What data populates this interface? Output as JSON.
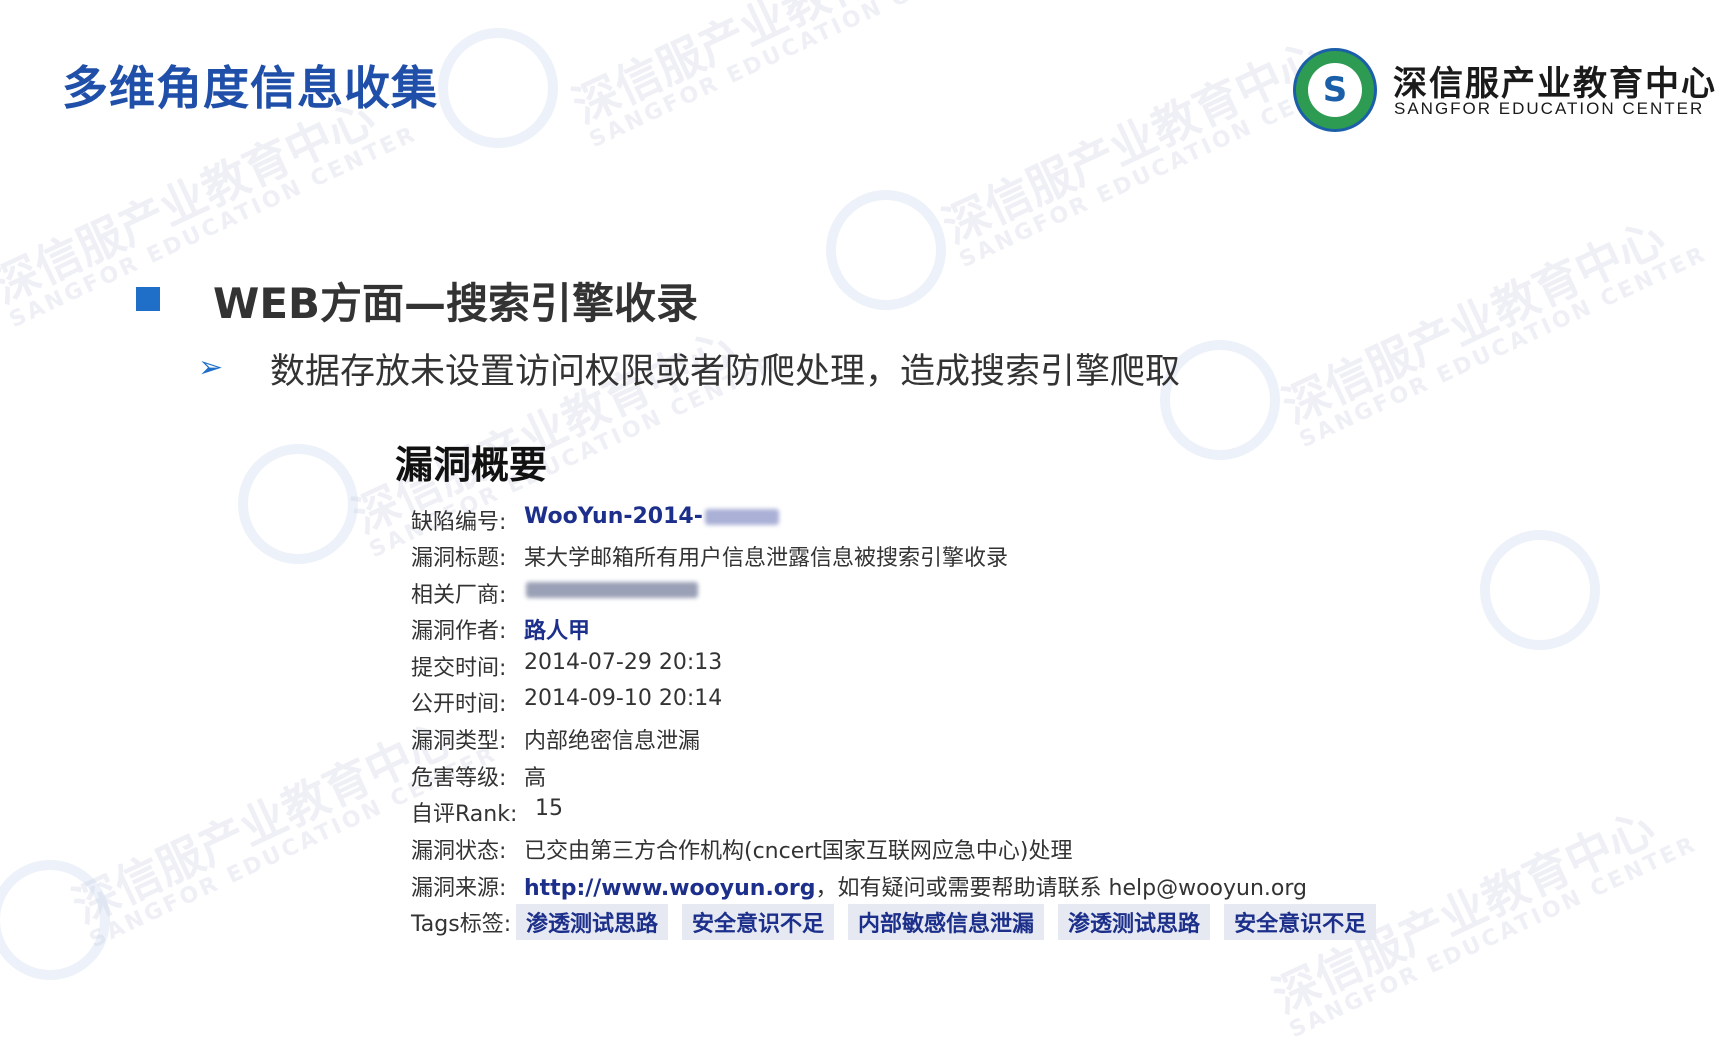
{
  "slide": {
    "title": "多维角度信息收集",
    "heading": "WEB方面—搜索引擎收录",
    "subpoint": "数据存放未设置访问权限或者防爬处理，造成搜索引擎爬取"
  },
  "logo": {
    "name_cn": "深信服产业教育中心",
    "name_en": "SANGFOR EDUCATION CENTER"
  },
  "watermark": {
    "text_cn": "深信服产业教育中心",
    "text_en": "SANGFOR EDUCATION CENTER"
  },
  "vuln": {
    "title": "漏洞概要",
    "id_label": "缺陷编号:",
    "id_value": "WooYun-2014-",
    "subject_label": "漏洞标题:",
    "subject_value": "某大学邮箱所有用户信息泄露信息被搜索引擎收录",
    "vendor_label": "相关厂商:",
    "author_label": "漏洞作者:",
    "author_value": "路人甲",
    "submitted_label": "提交时间:",
    "submitted_value": "2014-07-29 20:13",
    "published_label": "公开时间:",
    "published_value": "2014-09-10 20:14",
    "type_label": "漏洞类型:",
    "type_value": "内部绝密信息泄漏",
    "severity_label": "危害等级:",
    "severity_value": "高",
    "rank_label": "自评Rank:",
    "rank_value": "15",
    "status_label": "漏洞状态:",
    "status_value": "已交由第三方合作机构(cncert国家互联网应急中心)处理",
    "source_label": "漏洞来源:",
    "source_link": "http://www.wooyun.org",
    "source_note": "，如有疑问或需要帮助请联系 help@wooyun.org",
    "tags_label": "Tags标签:",
    "tags": [
      "渗透测试思路",
      "安全意识不足",
      "内部敏感信息泄漏",
      "渗透测试思路",
      "安全意识不足"
    ]
  },
  "colors": {
    "title_blue": "#1f4fa8",
    "accent_blue": "#1f6fc8",
    "link_blue": "#1c2f8a",
    "tag_bg": "#e6e9f2"
  }
}
